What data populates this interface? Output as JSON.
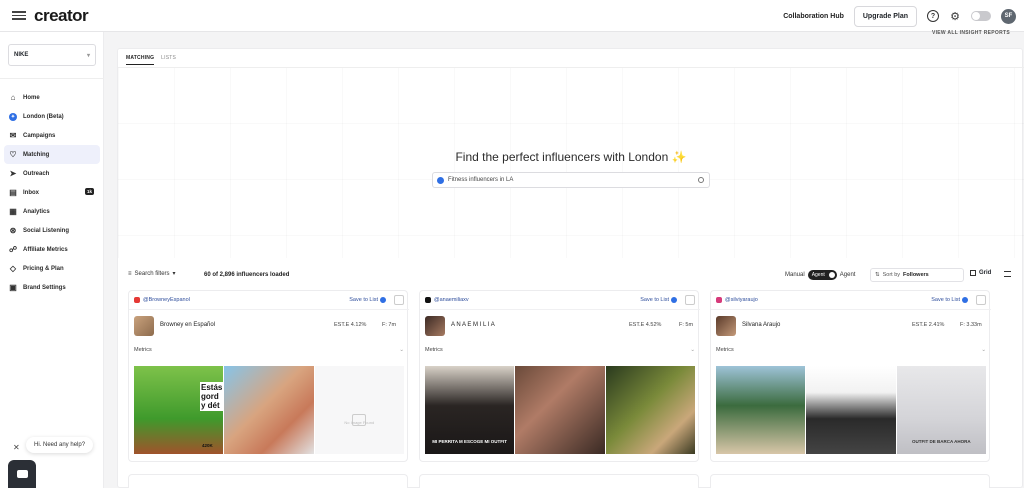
{
  "app": {
    "logo": "creator"
  },
  "header": {
    "collab_hub": "Collaboration Hub",
    "upgrade": "Upgrade Plan",
    "help_icon": "?",
    "avatar_initials": "SF",
    "insight_link": "VIEW ALL INSIGHT REPORTS"
  },
  "sidebar": {
    "brand": "NIKE",
    "items": [
      {
        "label": "Home",
        "icon": "home-icon"
      },
      {
        "label": "London (Beta)",
        "icon": "london-icon"
      },
      {
        "label": "Campaigns",
        "icon": "megaphone-icon"
      },
      {
        "label": "Matching",
        "icon": "heart-icon"
      },
      {
        "label": "Outreach",
        "icon": "outreach-icon"
      },
      {
        "label": "Inbox",
        "icon": "inbox-icon",
        "badge": "1k"
      },
      {
        "label": "Analytics",
        "icon": "analytics-icon"
      },
      {
        "label": "Social Listening",
        "icon": "antenna-icon"
      },
      {
        "label": "Affiliate Metrics",
        "icon": "affiliate-icon"
      },
      {
        "label": "Pricing & Plan",
        "icon": "tag-icon"
      },
      {
        "label": "Brand Settings",
        "icon": "settings-icon"
      }
    ],
    "active": "Matching",
    "help_text": "Hi. Need any help?"
  },
  "main": {
    "tabs": [
      "MATCHING",
      "LISTS"
    ],
    "hero_title": "Find the perfect influencers with London",
    "search_value": "Fitness influencers in LA",
    "search_filters": "Search filters",
    "loaded_text": "60 of 2,896 influencers loaded",
    "mode_manual": "Manual",
    "mode_agent_pill": "Agent",
    "mode_agent": "Agent",
    "sort_label": "Sort by",
    "sort_value": "Followers",
    "view_grid": "Grid",
    "accent": "#2f6fe4"
  },
  "cards": [
    {
      "platform": "youtube",
      "handle": "@BrowneyEspanol",
      "save": "Save to List",
      "name": "Browney en Español",
      "er": "EST.E 4.12%",
      "followers": "F: 7m",
      "metrics": "Metrics",
      "thumb1_text": "Estás gord y dét",
      "thumb1_sub": "420K",
      "empty_label": "No Image Found"
    },
    {
      "platform": "tiktok",
      "handle": "@anaemiliaxv",
      "save": "Save to List",
      "name": "A N A E M I L I A",
      "er": "EST.E 4.52%",
      "followers": "F: 5m",
      "metrics": "Metrics",
      "caption": "MI PERRITA M ESCOGE MI OUTFIT"
    },
    {
      "platform": "instagram",
      "handle": "@silviyaraujo",
      "save": "Save to List",
      "name": "Silvana Araujo",
      "er": "EST.E 2.41%",
      "followers": "F: 3.33m",
      "metrics": "Metrics",
      "caption": "OUTFIT DE BARCA AHORA"
    }
  ]
}
